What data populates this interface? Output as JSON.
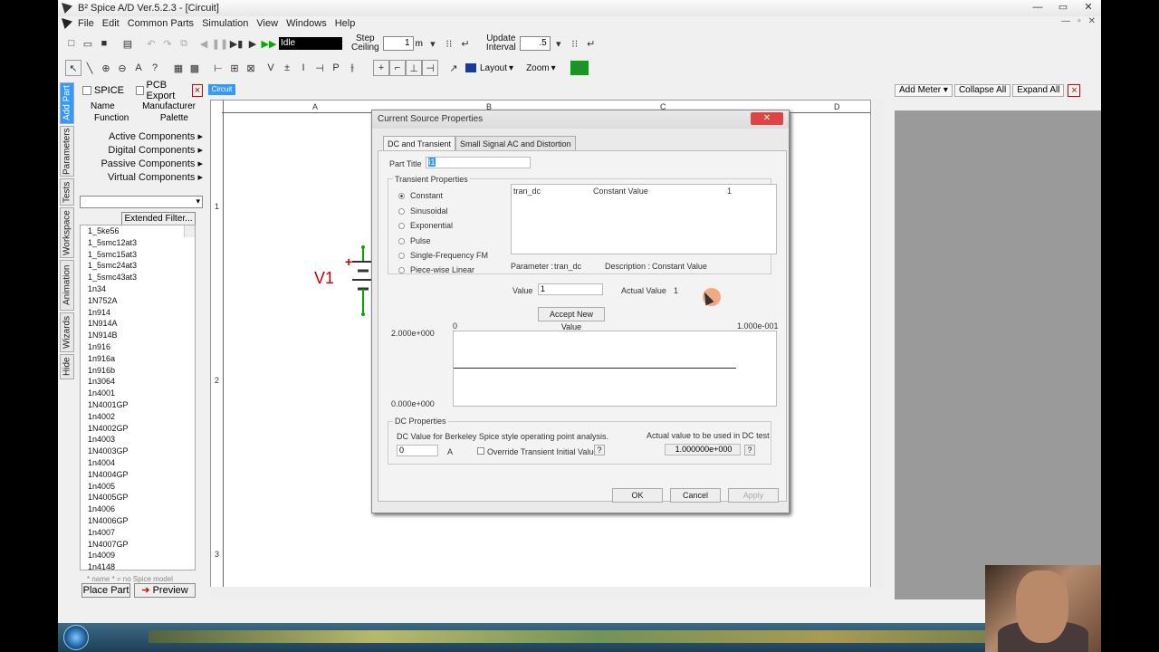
{
  "window": {
    "title": "B² Spice A/D Ver.5.2.3 - [Circuit]",
    "controls": [
      "—",
      "▭",
      "✕"
    ],
    "mdi_controls": [
      "—",
      "▫",
      "✕"
    ]
  },
  "menu": [
    "File",
    "Edit",
    "Common Parts",
    "Simulation",
    "View",
    "Windows",
    "Help"
  ],
  "toolbar": {
    "status": "Idle",
    "step_ceiling_label_1": "Step",
    "step_ceiling_label_2": "Ceiling",
    "step_value": "1",
    "step_unit": "m",
    "update_interval_label_1": "Update",
    "update_interval_label_2": "Interval",
    "update_value": ".5",
    "layout_label": "Layout",
    "zoom_label": "Zoom"
  },
  "sidetabs": [
    "Add Part",
    "Parameters",
    "Tests",
    "Workspace",
    "Animation",
    "Wizards",
    "Hide"
  ],
  "partpanel": {
    "spice_label": "SPICE",
    "pcb_label": "PCB Export",
    "col_name": "Name",
    "col_manufacturer": "Manufacturer",
    "col_function": "Function",
    "col_palette": "Palette",
    "categories": [
      "Active Components ▸",
      "Digital Components ▸",
      "Passive Components ▸",
      "Virtual Components ▸"
    ],
    "extended_filter": "Extended Filter...",
    "parts": [
      "1_5ke56",
      "1_5smc12at3",
      "1_5smc15at3",
      "1_5smc24at3",
      "1_5smc43at3",
      "1n34",
      "1N752A",
      "1n914",
      "1N914A",
      "1N914B",
      "1n916",
      "1n916a",
      "1n916b",
      "1n3064",
      "1n4001",
      "1N4001GP",
      "1n4002",
      "1N4002GP",
      "1n4003",
      "1N4003GP",
      "1n4004",
      "1N4004GP",
      "1n4005",
      "1N4005GP",
      "1n4006",
      "1N4006GP",
      "1n4007",
      "1N4007GP",
      "1n4009",
      "1n4148"
    ],
    "hint": "* name * = no Spice model",
    "place_part": "Place Part",
    "preview": "Preview"
  },
  "circuit": {
    "tab": "Circuit",
    "columns": [
      "A",
      "B",
      "C",
      "D"
    ],
    "rows": [
      "1",
      "2",
      "3"
    ],
    "component_label": "V1",
    "plus_sign": "+"
  },
  "meters": {
    "add_meter": "Add Meter ▾",
    "collapse_all": "Collapse All",
    "expand_all": "Expand All"
  },
  "dialog": {
    "title": "Current Source Properties",
    "close": "✕",
    "tabs": [
      "DC and Transient",
      "Small Signal AC and Distortion"
    ],
    "part_title_label": "Part Title",
    "part_title_value": "I1",
    "transient_group": "Transient Properties",
    "waveforms": [
      "Constant",
      "Sinusoidal",
      "Exponential",
      "Pulse",
      "Single-Frequency FM",
      "Piece-wise Linear"
    ],
    "selected_waveform": "Constant",
    "table_row": {
      "param": "tran_dc",
      "desc": "Constant Value",
      "value": "1"
    },
    "parameter_label": "Parameter :",
    "parameter_value": "tran_dc",
    "description_label": "Description :",
    "description_value": "Constant Value",
    "value_label": "Value",
    "value_value": "1",
    "actual_value_label": "Actual Value",
    "actual_value": "1",
    "accept_button": "Accept New Value",
    "graph": {
      "y_max": "2.000e+000",
      "y_min": "0.000e+000",
      "x_min": "0",
      "x_max": "1.000e-001"
    },
    "dc_group": "DC Properties",
    "dc_desc": "DC Value for Berkeley Spice style operating point analysis.",
    "dc_value": "0",
    "dc_unit": "A",
    "override_label": "Override Transient Initial Value",
    "actual_dc_label": "Actual value to be used in DC test",
    "actual_dc_value": "1.000000e+000",
    "help": "?",
    "ok": "OK",
    "cancel": "Cancel",
    "apply": "Apply"
  }
}
